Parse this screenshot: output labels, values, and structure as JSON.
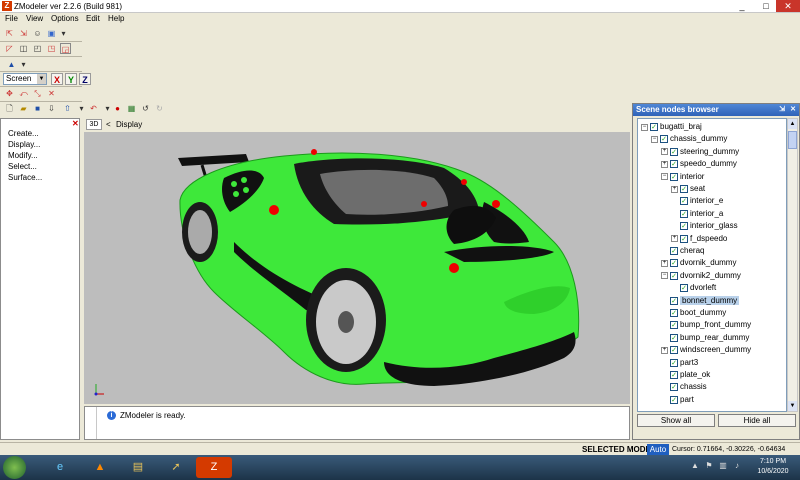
{
  "window": {
    "title": "ZModeler ver 2.2.6 (Build 981)",
    "app_icon_letter": "Z",
    "min": "_",
    "max": "□",
    "close": "✕"
  },
  "menu": [
    "File",
    "View",
    "Options",
    "Edit",
    "Help"
  ],
  "toolbar": {
    "view_mode": "Screen",
    "axis_x": "X",
    "axis_y": "Y",
    "axis_z": "Z"
  },
  "commands": [
    "Create...",
    "Display...",
    "Modify...",
    "Select...",
    "Surface..."
  ],
  "viewport": {
    "mode_button": "3D",
    "arrow": "<",
    "label": "Display",
    "colors": {
      "car_body": "#3ee83a",
      "background": "#bdbdbd"
    }
  },
  "status_message": "ZModeler is ready.",
  "scene_browser": {
    "title": "Scene nodes browser",
    "nodes": [
      {
        "label": "bugatti_braj",
        "level": 0,
        "expand": "−"
      },
      {
        "label": "chassis_dummy",
        "level": 1,
        "expand": "−"
      },
      {
        "label": "steering_dummy",
        "level": 2,
        "expand": "+"
      },
      {
        "label": "speedo_dummy",
        "level": 2,
        "expand": "+"
      },
      {
        "label": "interior",
        "level": 2,
        "expand": "−"
      },
      {
        "label": "seat",
        "level": 3,
        "expand": "+"
      },
      {
        "label": "interior_e",
        "level": 3,
        "expand": ""
      },
      {
        "label": "interior_a",
        "level": 3,
        "expand": ""
      },
      {
        "label": "interior_glass",
        "level": 3,
        "expand": ""
      },
      {
        "label": "f_dspeedo",
        "level": 3,
        "expand": "+"
      },
      {
        "label": "cheraq",
        "level": 2,
        "expand": ""
      },
      {
        "label": "dvornik_dummy",
        "level": 2,
        "expand": "+"
      },
      {
        "label": "dvornik2_dummy",
        "level": 2,
        "expand": "−"
      },
      {
        "label": "dvorleft",
        "level": 3,
        "expand": ""
      },
      {
        "label": "bonnet_dummy",
        "level": 2,
        "expand": "",
        "selected": true
      },
      {
        "label": "boot_dummy",
        "level": 2,
        "expand": ""
      },
      {
        "label": "bump_front_dummy",
        "level": 2,
        "expand": ""
      },
      {
        "label": "bump_rear_dummy",
        "level": 2,
        "expand": ""
      },
      {
        "label": "windscreen_dummy",
        "level": 2,
        "expand": "+"
      },
      {
        "label": "part3",
        "level": 2,
        "expand": ""
      },
      {
        "label": "plate_ok",
        "level": 2,
        "expand": ""
      },
      {
        "label": "chassis",
        "level": 2,
        "expand": ""
      },
      {
        "label": "part",
        "level": 2,
        "expand": ""
      }
    ],
    "show_all": "Show all",
    "hide_all": "Hide all"
  },
  "statusbar": {
    "selected_mode": "SELECTED MODE",
    "auto": "Auto",
    "cursor": "Cursor: 0.71664, -0.30226, -0.64634"
  },
  "tray": {
    "time": "7:10 PM",
    "date": "10/6/2020"
  },
  "icons": {
    "check": "✓"
  }
}
